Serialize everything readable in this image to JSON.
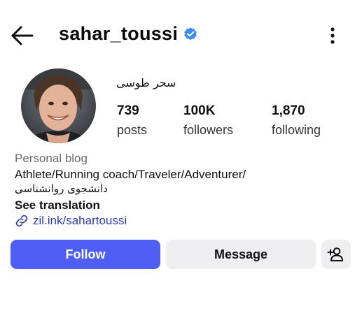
{
  "header": {
    "username": "sahar_toussi",
    "back_icon": "arrow-left-icon",
    "verified_icon": "verified-badge-icon",
    "more_icon": "kebab-menu-icon"
  },
  "profile": {
    "display_name": "سحر طوسی",
    "stats": [
      {
        "value": "739",
        "label": "posts"
      },
      {
        "value": "100K",
        "label": "followers"
      },
      {
        "value": "1,870",
        "label": "following"
      }
    ],
    "category": "Personal blog",
    "bio_line1": "Athlete/Running coach/Traveler/Adventurer/",
    "bio_line2": "دانشجوی روانشناسی",
    "see_translation": "See translation",
    "link": "zil.ink/sahartoussi"
  },
  "actions": {
    "follow": "Follow",
    "message": "Message",
    "add_user_icon": "add-person-icon"
  },
  "colors": {
    "follow_bg": "#4f5ef5",
    "secondary_btn_bg": "#efeff2",
    "verified": "#3c8cf0",
    "link": "#2e3aa8"
  }
}
